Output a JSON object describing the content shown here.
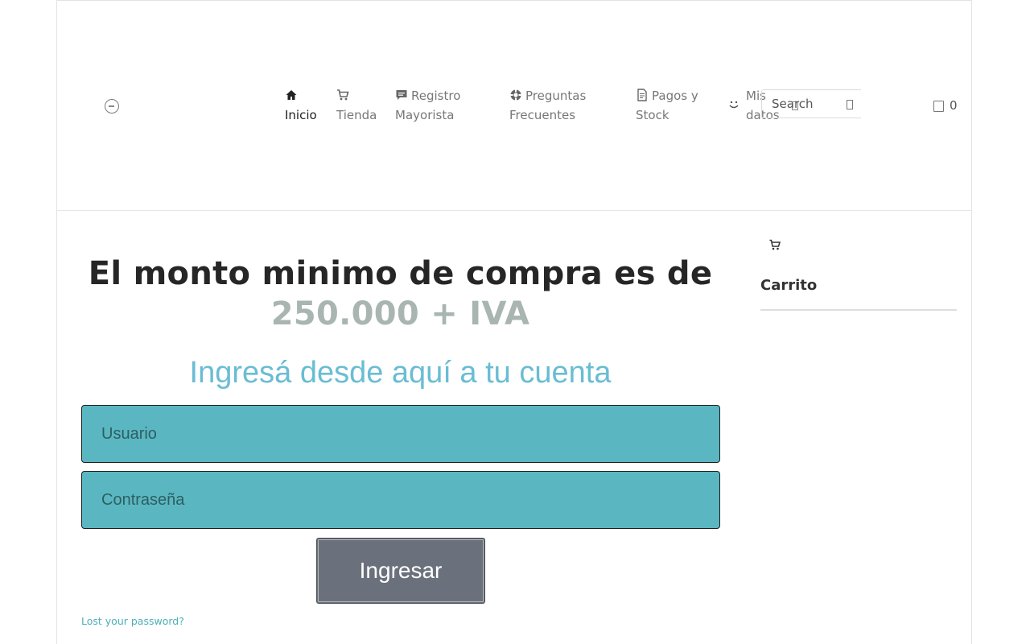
{
  "nav": {
    "items": [
      {
        "label_line1": "Inicio",
        "label_line2": "",
        "icon": "home-icon",
        "active": true
      },
      {
        "label_line1": "Tienda",
        "label_line2": "",
        "icon": "cart-icon",
        "active": false
      },
      {
        "label_line1": "Registro",
        "label_line2": "Mayorista",
        "icon": "comment-icon",
        "active": false
      },
      {
        "label_line1": "Preguntas",
        "label_line2": "Frecuentes",
        "icon": "lifebuoy-icon",
        "active": false
      },
      {
        "label_line1": "Pagos y",
        "label_line2": "Stock",
        "icon": "document-icon",
        "active": false
      },
      {
        "label_line1": "Mis",
        "label_line2": "datos",
        "icon": "smile-icon",
        "active": false
      }
    ]
  },
  "search": {
    "placeholder": "Search"
  },
  "cart": {
    "count": "0"
  },
  "main": {
    "heading_line1": "El monto minimo de compra es de",
    "heading_amount": "250.000 + IVA",
    "subheading": "Ingresá desde aquí a tu cuenta",
    "username_placeholder": "Usuario",
    "password_placeholder": "Contraseña",
    "submit_label": "Ingresar",
    "lost_password": "Lost your password?"
  },
  "sidebar": {
    "title": "Carrito"
  },
  "colors": {
    "accent_teal": "#5ab7c1",
    "subheading_blue": "#69bdd3",
    "button_gray": "#6b717c",
    "amount_gray": "#a9b5b1"
  }
}
